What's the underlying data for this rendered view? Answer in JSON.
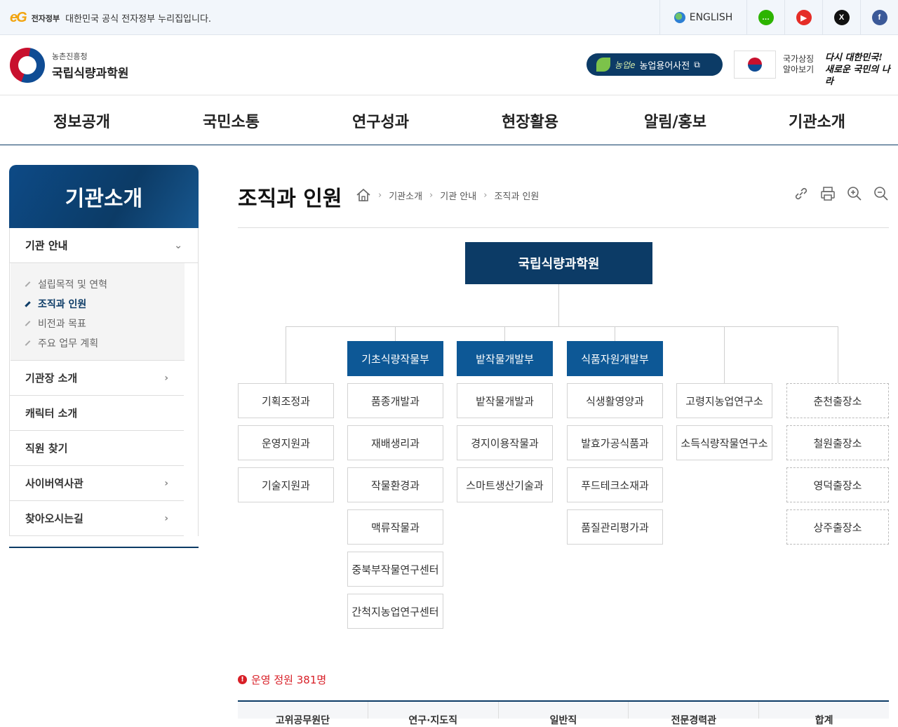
{
  "govbar": {
    "eg_logo": "eG",
    "eg_tag": "전자정부",
    "notice": "대한민국 공식 전자정부 누리집입니다.",
    "english": "ENGLISH",
    "sns": [
      {
        "name": "blog-icon",
        "color": "#2db400",
        "glyph": "blog"
      },
      {
        "name": "youtube-icon",
        "color": "#e52d27",
        "glyph": "▶"
      },
      {
        "name": "x-icon",
        "color": "#111111",
        "glyph": "X"
      },
      {
        "name": "facebook-icon",
        "color": "#3b5998",
        "glyph": "f"
      }
    ]
  },
  "header": {
    "logo_sub": "농촌진흥청",
    "logo_main": "국립식량과학원",
    "dict_brand": "농업e",
    "dict_label": "농업용어사전",
    "flag_line1": "국가상징",
    "flag_line2": "알아보기",
    "slogan_line1": "다시 대한민국!",
    "slogan_line2": "새로운 국민의 나라"
  },
  "gnb": [
    "정보공개",
    "국민소통",
    "연구성과",
    "현장활용",
    "알림/홍보",
    "기관소개"
  ],
  "sidebar": {
    "title": "기관소개",
    "group_title": "기관 안내",
    "sub_items": [
      "설립목적 및 연혁",
      "조직과 인원",
      "비전과 목표",
      "주요 업무 계획"
    ],
    "items": [
      {
        "label": "기관장 소개",
        "arrow": "›"
      },
      {
        "label": "캐릭터 소개",
        "arrow": ""
      },
      {
        "label": "직원 찾기",
        "arrow": ""
      },
      {
        "label": "사이버역사관",
        "arrow": "›"
      },
      {
        "label": "찾아오시는길",
        "arrow": "›"
      }
    ]
  },
  "content": {
    "title": "조직과 인원",
    "breadcrumb": [
      "기관소개",
      "기관 안내",
      "조직과 인원"
    ]
  },
  "org": {
    "root": "국립식량과학원",
    "depts": [
      "기초식량작물부",
      "밭작물개발부",
      "식품자원개발부"
    ],
    "col1": [
      "기획조정과",
      "운영지원과",
      "기술지원과"
    ],
    "col2": [
      "품종개발과",
      "재배생리과",
      "작물환경과",
      "맥류작물과",
      "중북부작물연구센터",
      "간척지농업연구센터"
    ],
    "col3": [
      "밭작물개발과",
      "경지이용작물과",
      "스마트생산기술과"
    ],
    "col4": [
      "식생활영양과",
      "발효가공식품과",
      "푸드테크소재과",
      "품질관리평가과"
    ],
    "col5": [
      "고령지농업연구소",
      "소득식량작물연구소"
    ],
    "col6": [
      "춘천출장소",
      "철원출장소",
      "영덕출장소",
      "상주출장소"
    ]
  },
  "staff": {
    "notice": "운영 정원 381명",
    "headers": [
      "고위공무원단",
      "연구·지도직",
      "일반직",
      "전문경력관",
      "합계"
    ]
  }
}
